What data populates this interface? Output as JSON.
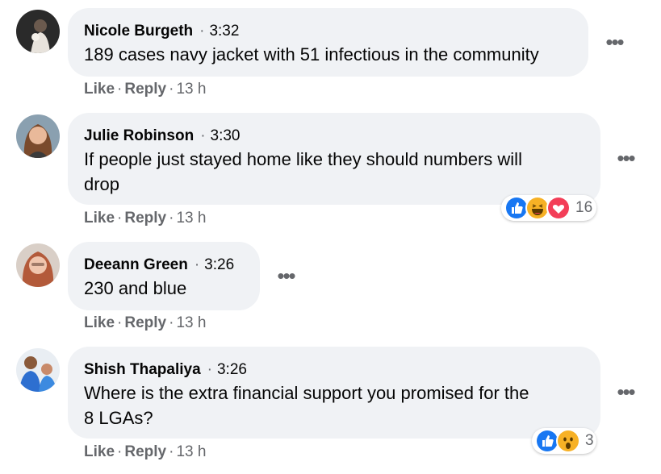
{
  "comments": [
    {
      "author": "Nicole Burgeth",
      "time": "3:32",
      "text": "189 cases navy jacket with 51 infectious in the community",
      "like": "Like",
      "reply": "Reply",
      "age": "13 h",
      "avatar_icon": "avatar-photo-icon",
      "reactions": null
    },
    {
      "author": "Julie Robinson",
      "time": "3:30",
      "text_line1": "If people just stayed home like they should numbers will",
      "text_line2": "drop",
      "like": "Like",
      "reply": "Reply",
      "age": "13 h",
      "avatar_icon": "avatar-photo-icon",
      "reactions": {
        "icons": [
          "like-reaction-icon",
          "haha-reaction-icon",
          "love-reaction-icon"
        ],
        "count": "16"
      }
    },
    {
      "author": "Deeann Green",
      "time": "3:26",
      "text": "230 and blue",
      "like": "Like",
      "reply": "Reply",
      "age": "13 h",
      "avatar_icon": "avatar-photo-icon",
      "reactions": null
    },
    {
      "author": "Shish Thapaliya",
      "time": "3:26",
      "text_line1": "Where is the extra financial support you promised for the",
      "text_line2": "8 LGAs?",
      "like": "Like",
      "reply": "Reply",
      "age": "13 h",
      "avatar_icon": "avatar-photo-icon",
      "reactions": {
        "icons": [
          "like-reaction-icon",
          "wow-reaction-icon"
        ],
        "count": "3"
      }
    }
  ],
  "separators": {
    "dot": "·",
    "more": "•••"
  },
  "colors": {
    "bubble": "#f0f2f5",
    "secondary_text": "#65676b",
    "like_blue": "#1877f2",
    "love_red": "#f33e58",
    "haha_yellow": "#f7b125"
  }
}
